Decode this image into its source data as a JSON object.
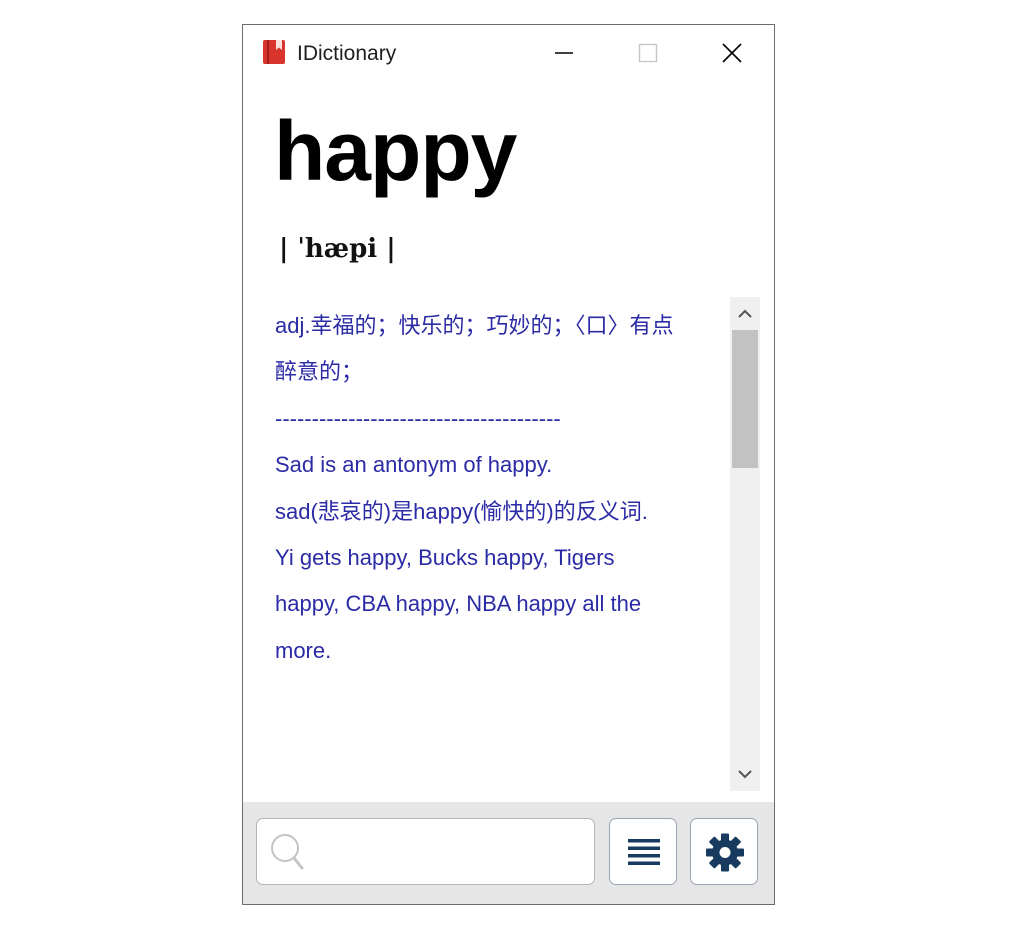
{
  "window": {
    "title": "IDictionary",
    "controls": [
      "minimize",
      "maximize",
      "close"
    ]
  },
  "entry": {
    "word": "happy",
    "phonetic": "| ˈhæpi |",
    "lines": [
      "adj.幸福的；快乐的；巧妙的；〈口〉有点",
      "醉意的；",
      "---------------------------------------",
      "Sad is an antonym of happy.",
      "",
      "sad(悲哀的)是happy(愉快的)的反义词.",
      "",
      "Yi gets happy, Bucks happy, Tigers",
      "happy, CBA happy, NBA happy all the",
      "more."
    ]
  },
  "search": {
    "value": "",
    "placeholder": ""
  },
  "toolbar": {
    "list_icon": "list-icon",
    "settings_icon": "gear-icon"
  },
  "colors": {
    "definition_text": "#2b2ba6",
    "app_icon": "#d9342b",
    "toolbar_icon": "#173a5e",
    "bottom_bar": "#e6e6e6"
  }
}
